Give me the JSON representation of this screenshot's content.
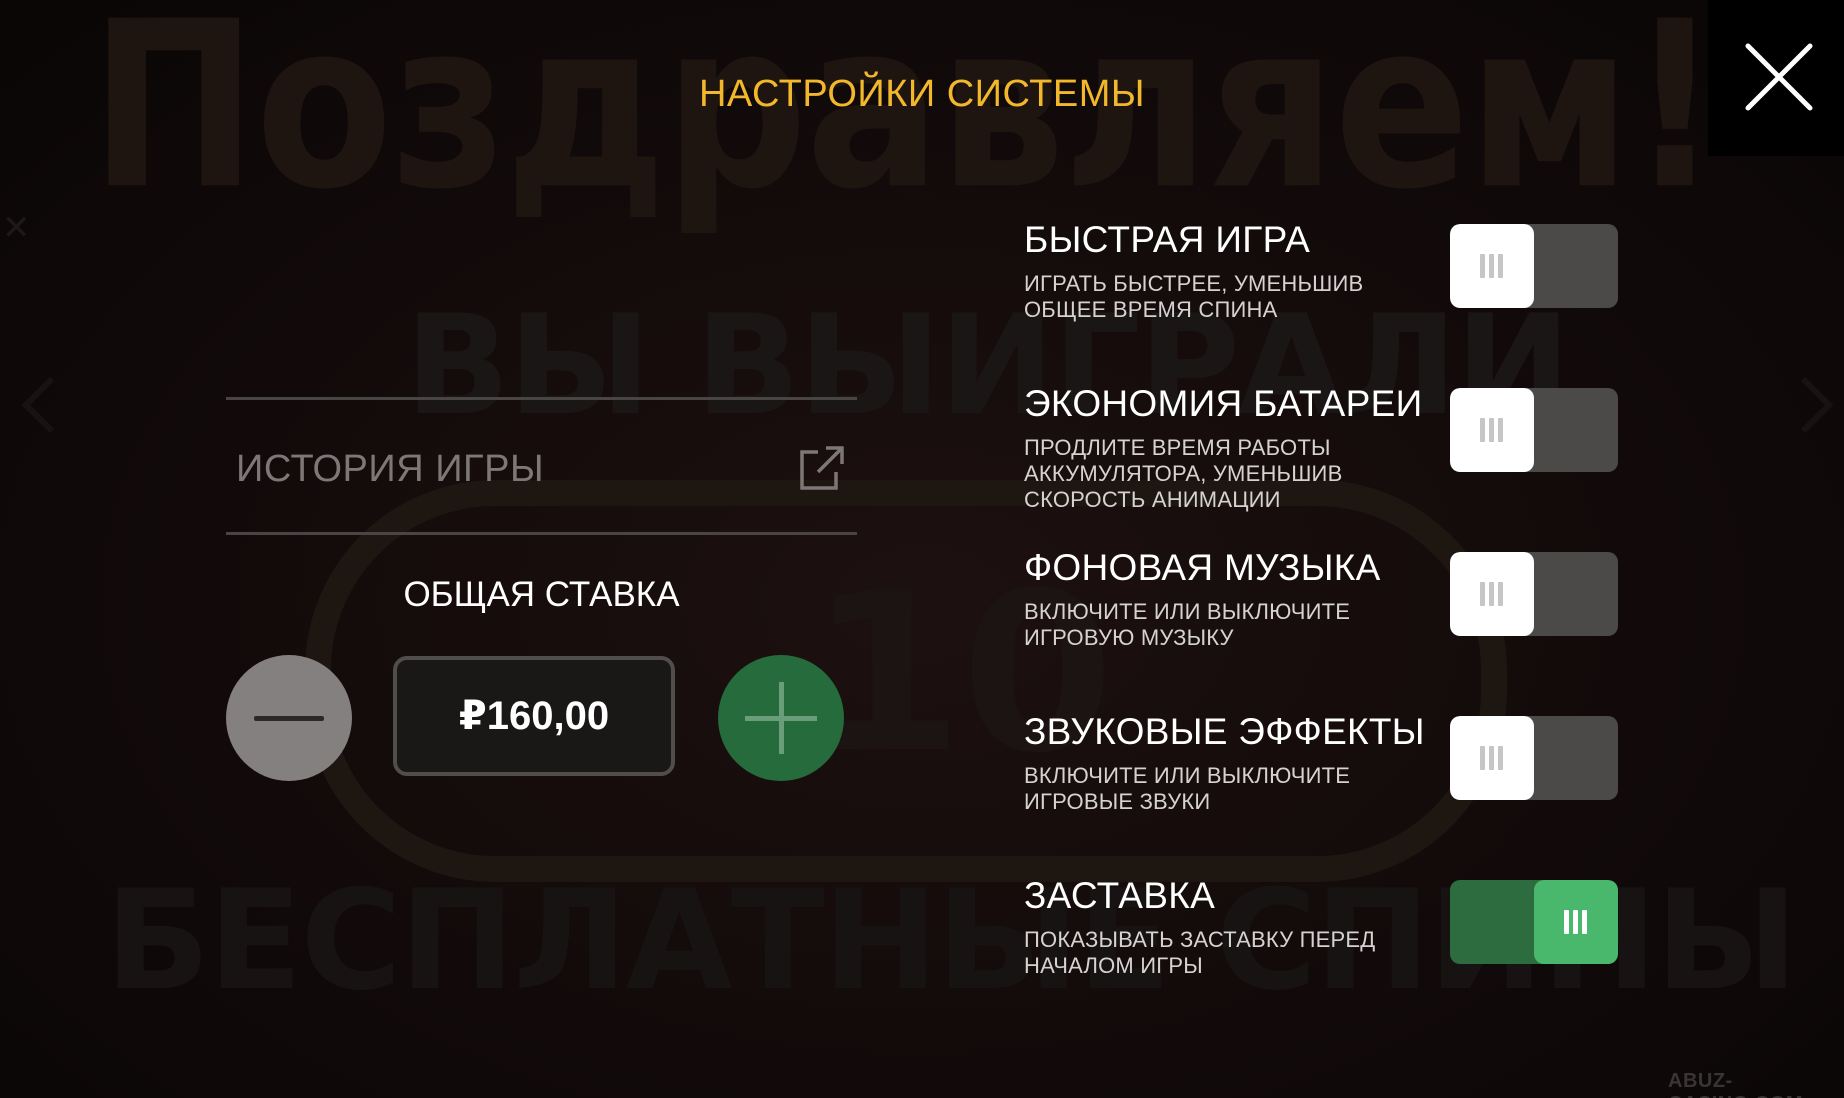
{
  "background": {
    "line1": "Поздравляем!",
    "line2": "ВЫ ВЫИГРАЛИ",
    "line3": "10",
    "line4": "БЕСПЛАТНЫЕ СПИНЫ"
  },
  "header": {
    "title": "НАСТРОЙКИ СИСТЕМЫ",
    "close_icon": "close-icon"
  },
  "history": {
    "label": "ИСТОРИЯ ИГРЫ",
    "icon": "external-link-icon"
  },
  "bet": {
    "label": "ОБЩАЯ СТАВКА",
    "value": "₽160,00",
    "decrease_icon": "minus-icon",
    "increase_icon": "plus-icon"
  },
  "settings": [
    {
      "title": "БЫСТРАЯ ИГРА",
      "description": "ИГРАТЬ БЫСТРЕЕ, УМЕНЬШИВ ОБЩЕЕ ВРЕМЯ СПИНА",
      "enabled": false
    },
    {
      "title": "ЭКОНОМИЯ БАТАРЕИ",
      "description": "ПРОДЛИТЕ ВРЕМЯ РАБОТЫ АККУМУЛЯТОРА, УМЕНЬШИВ СКОРОСТЬ АНИМАЦИИ",
      "enabled": false
    },
    {
      "title": "ФОНОВАЯ МУЗЫКА",
      "description": "ВКЛЮЧИТЕ ИЛИ ВЫКЛЮЧИТЕ ИГРОВУЮ МУЗЫКУ",
      "enabled": false
    },
    {
      "title": "ЗВУКОВЫЕ ЭФФЕКТЫ",
      "description": "ВКЛЮЧИТЕ ИЛИ ВЫКЛЮЧИТЕ ИГРОВЫЕ ЗВУКИ",
      "enabled": false
    },
    {
      "title": "ЗАСТАВКА",
      "description": "ПОКАЗЫВАТЬ ЗАСТАВКУ ПЕРЕД НАЧАЛОМ ИГРЫ",
      "enabled": true
    }
  ],
  "watermark": "ABUZ-CASINO.COM",
  "colors": {
    "title_accent": "#f3b72b",
    "toggle_on": "#4ab86c",
    "plus_button": "#256b3b"
  }
}
